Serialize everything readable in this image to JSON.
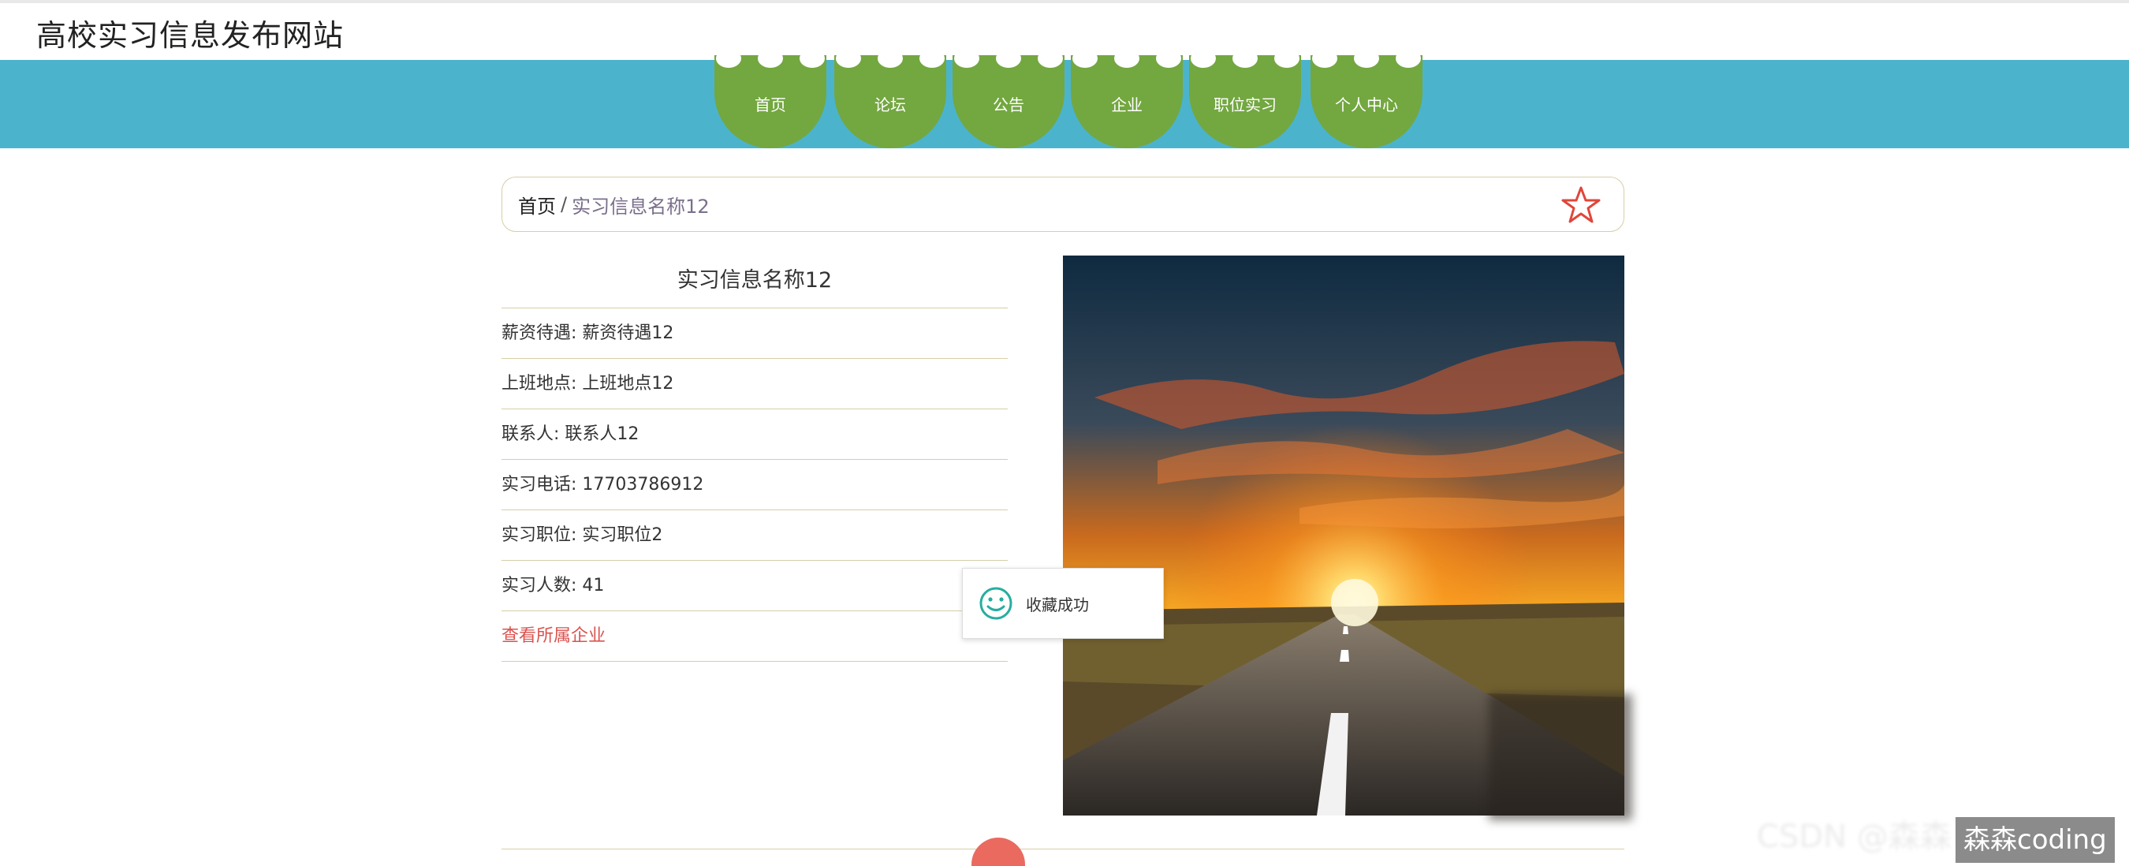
{
  "site": {
    "title": "高校实习信息发布网站"
  },
  "nav": {
    "items": [
      {
        "label": "首页"
      },
      {
        "label": "论坛"
      },
      {
        "label": "公告"
      },
      {
        "label": "企业"
      },
      {
        "label": "职位实习"
      },
      {
        "label": "个人中心"
      }
    ]
  },
  "breadcrumb": {
    "home": "首页",
    "separator": "/",
    "current": "实习信息名称12"
  },
  "detail": {
    "title": "实习信息名称12",
    "rows": [
      {
        "text": "薪资待遇: 薪资待遇12"
      },
      {
        "text": "上班地点: 上班地点12"
      },
      {
        "text": "联系人: 联系人12"
      },
      {
        "text": "实习电话: 17703786912"
      },
      {
        "text": "实习职位: 实习职位2"
      },
      {
        "text": "实习人数: 41"
      }
    ],
    "company_link": "查看所属企业"
  },
  "toast": {
    "message": "收藏成功"
  },
  "watermark": {
    "faint": "CSDN @森森",
    "label": "森森coding"
  },
  "colors": {
    "nav_band": "#4bb4cc",
    "nav_tab": "#73a740",
    "link_red": "#d9534f",
    "star": "#e0463a"
  }
}
